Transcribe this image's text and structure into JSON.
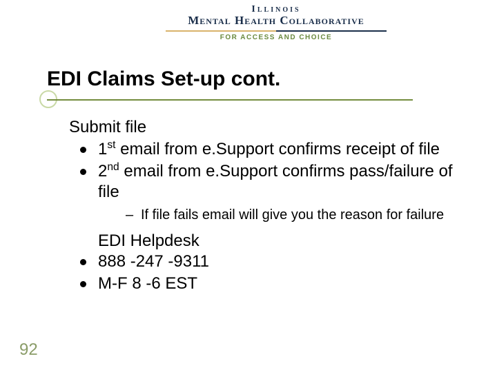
{
  "logo": {
    "line1": "Illinois",
    "line2": "Mental Health Collaborative",
    "tagline": "FOR ACCESS AND CHOICE"
  },
  "title": "EDI Claims Set-up cont.",
  "section_head": "Submit file",
  "bullets": {
    "b1_pre": "1",
    "b1_sup": "st",
    "b1_post": " email from e.Support confirms receipt of file",
    "b2_pre": "2",
    "b2_sup": "nd",
    "b2_post": " email from e.Support confirms pass/failure of file",
    "sub1": "If file fails email will give you the reason for failure",
    "helpdesk_title": "EDI Helpdesk",
    "phone": "888 -247 -9311",
    "hours": "M-F 8 -6 EST"
  },
  "slide_number": "92"
}
